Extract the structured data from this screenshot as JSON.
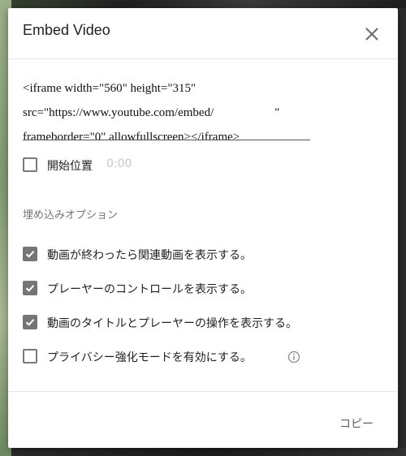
{
  "dialog": {
    "title": "Embed Video",
    "close_icon": "close-icon"
  },
  "embed_code": {
    "lines": [
      "<iframe width=\"560\" height=\"315\"",
      "src=\"https://www.youtube.com/embed/                    \"",
      "frameborder=\"0\" allowfullscreen></iframe>"
    ]
  },
  "start_position": {
    "label": "開始位置",
    "value": "0:00",
    "checked": false
  },
  "options": {
    "heading": "埋め込みオプション",
    "items": [
      {
        "label": "動画が終わったら関連動画を表示する。",
        "checked": true
      },
      {
        "label": "プレーヤーのコントロールを表示する。",
        "checked": true
      },
      {
        "label": "動画のタイトルとプレーヤーの操作を表示する。",
        "checked": true
      },
      {
        "label": "プライバシー強化モードを有効にする。",
        "checked": false
      }
    ],
    "info_icon": "info-icon"
  },
  "footer": {
    "copy_label": "コピー"
  },
  "colors": {
    "checkbox_checked": "#757575",
    "text_primary": "#1f1f1f",
    "text_muted": "#757575"
  }
}
